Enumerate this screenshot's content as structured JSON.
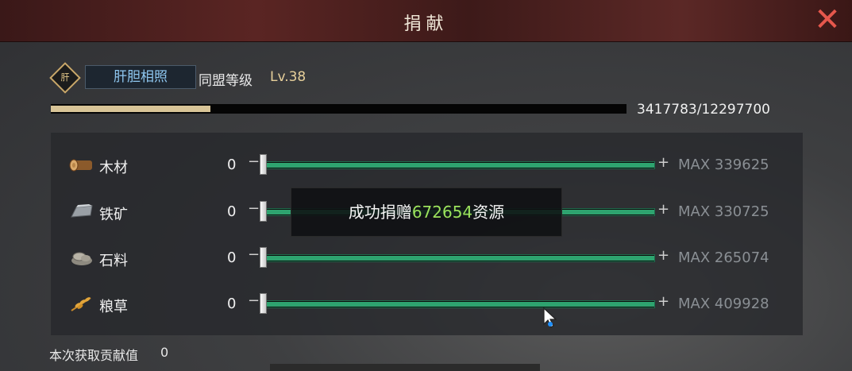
{
  "window": {
    "title": "捐献",
    "close_icon": "close-icon"
  },
  "alliance": {
    "emblem_icon": "alliance-emblem-icon",
    "emblem_char": "肝",
    "name": "肝胆相照",
    "level_label": "同盟等级",
    "level_value": "Lv.38"
  },
  "progress": {
    "current": 3417783,
    "total": 12297700,
    "text": "3417783/12297700"
  },
  "resources": [
    {
      "icon": "wood-icon",
      "name": "木材",
      "value": "0",
      "minus": "−",
      "plus": "+",
      "max_label": "MAX 339625",
      "fill": 1.0
    },
    {
      "icon": "iron-ore-icon",
      "name": "铁矿",
      "value": "0",
      "minus": "−",
      "plus": "+",
      "max_label": "MAX 330725",
      "fill": 1.0
    },
    {
      "icon": "stone-icon",
      "name": "石料",
      "value": "0",
      "minus": "−",
      "plus": "+",
      "max_label": "MAX 265074",
      "fill": 1.0
    },
    {
      "icon": "grain-icon",
      "name": "粮草",
      "value": "0",
      "minus": "−",
      "plus": "+",
      "max_label": "MAX 409928",
      "fill": 1.0
    }
  ],
  "toast": {
    "prefix": "成功捐赠",
    "amount": "672654",
    "suffix": "资源"
  },
  "contribution": {
    "label": "本次获取贡献值",
    "value": "0"
  },
  "colors": {
    "title_bar": "#5a2523",
    "accent_gold": "#d8c497",
    "slider_green": "#2ea36f",
    "close_red": "#e6574c",
    "toast_highlight": "#9be35c",
    "alliance_name_blue": "#8ec7f0"
  }
}
